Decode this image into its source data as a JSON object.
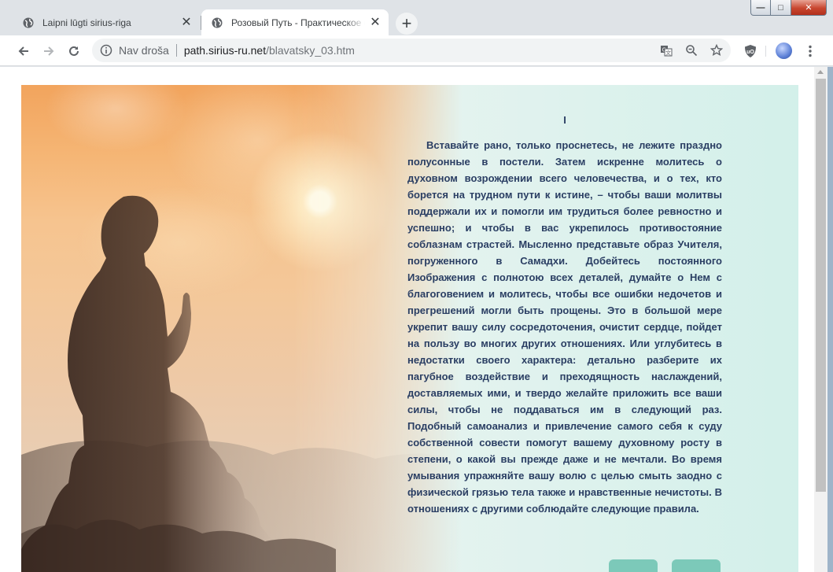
{
  "browser": {
    "tabs": [
      {
        "label": "Laipni lūgti sirius-riga",
        "active": false
      },
      {
        "label": "Розовый Путь - Практическое о",
        "active": true
      }
    ],
    "new_tab_label": "+",
    "close_glyph": "✕",
    "address": {
      "security_label": "Nav droša",
      "host": "path.sirius-ru.net",
      "path": "/blavatsky_03.htm"
    },
    "window_controls": {
      "minimize": "—",
      "maximize": "□",
      "close": "✕"
    },
    "icons": [
      "back-icon",
      "forward-icon",
      "reload-icon",
      "info-icon",
      "translate-icon",
      "zoom-out-icon",
      "star-icon",
      "ublock-icon",
      "profile-avatar",
      "menu-icon"
    ]
  },
  "page": {
    "chapter": "I",
    "paragraph": "Вставайте рано, только проснетесь, не лежите праздно полусонные в постели. Затем искренне молитесь о духовном возрождении всего человечества, и о тех, кто борется на трудном пути к истине, – чтобы ваши молитвы поддержали их и помогли им трудиться более ревностно и успешно; и чтобы в вас укрепилось противостояние соблазнам страстей. Мысленно представьте образ Учителя, погруженного в Самадхи. Добейтесь постоянного Изображения с полнотою всех деталей, думайте о Нем с благоговением и молитесь, чтобы все ошибки недочетов и прегрешений могли быть прощены. Это в большой мере укрепит вашу силу сосредоточения, очистит сердце, пойдет на пользу во многих других отношениях. Или углубитесь в недостатки своего характера: детально разберите их пагубное воздействие и преходящность наслаждений, доставляемых ими, и твердо желайте приложить все ваши силы, чтобы не поддаваться им в следующий раз. Подобный самоанализ и привлечение самого себя к суду собственной совести помогут вашему духовному росту в степени, о какой вы прежде даже и не мечтали. Во время умывания упражняйте вашу волю с целью смыть заодно с физической грязью тела также и нравственные нечистоты. В отношениях с другими соблюдайте следующие правила.",
    "colors": {
      "text": "#2a3e63",
      "sky_top": "#f2a45d",
      "mint": "#d3f0ea",
      "nav_button": "#7cc9b9"
    }
  }
}
